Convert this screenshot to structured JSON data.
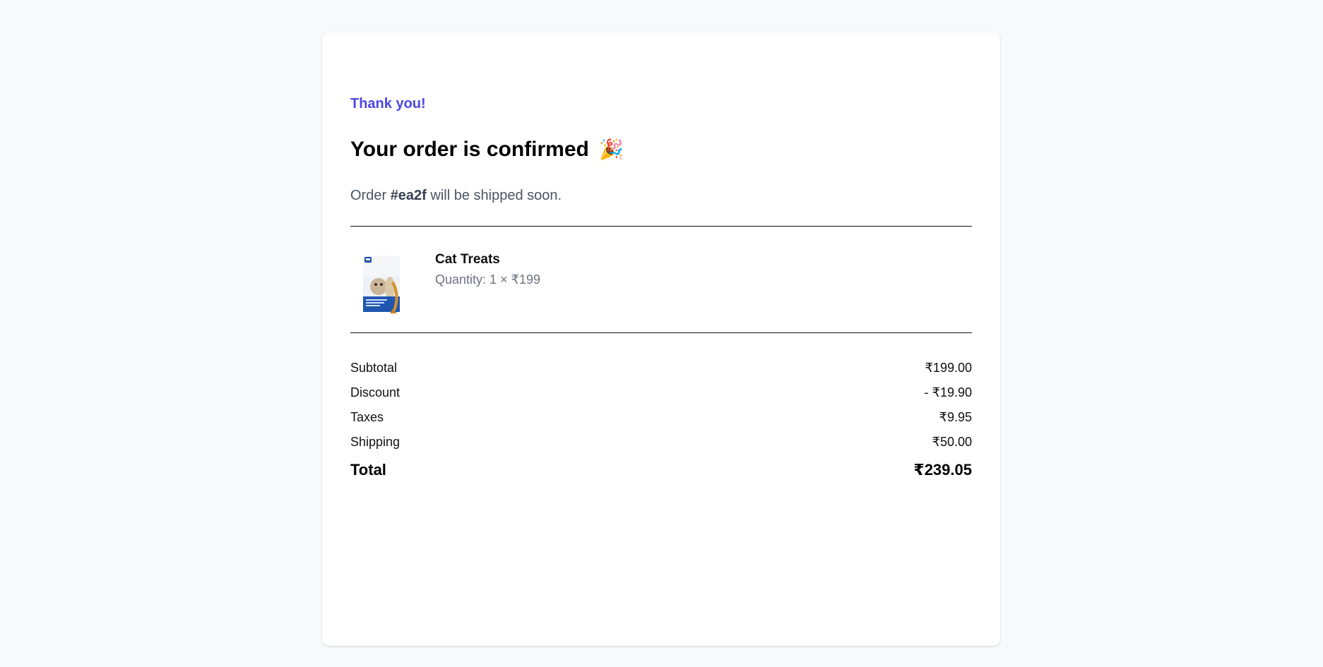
{
  "header": {
    "thanks": "Thank you!",
    "headline": "Your order is confirmed",
    "headline_emoji": "🎉",
    "order_prefix": "Order",
    "order_id": "#ea2f",
    "order_suffix": "will be shipped soon."
  },
  "item": {
    "name": "Cat Treats",
    "quantity_text": "Quantity: 1 × ₹199",
    "image_icon": "cat-treats-pack-image"
  },
  "summary": {
    "rows": [
      {
        "label": "Subtotal",
        "value": "₹199.00"
      },
      {
        "label": "Discount",
        "value": "- ₹19.90"
      },
      {
        "label": "Taxes",
        "value": "₹9.95"
      },
      {
        "label": "Shipping",
        "value": "₹50.00"
      }
    ],
    "total_label": "Total",
    "total_value": "₹239.05"
  },
  "colors": {
    "accent": "#4f46e5",
    "background": "#f8f9fb",
    "card": "#ffffff",
    "muted_text": "#6b7280"
  }
}
